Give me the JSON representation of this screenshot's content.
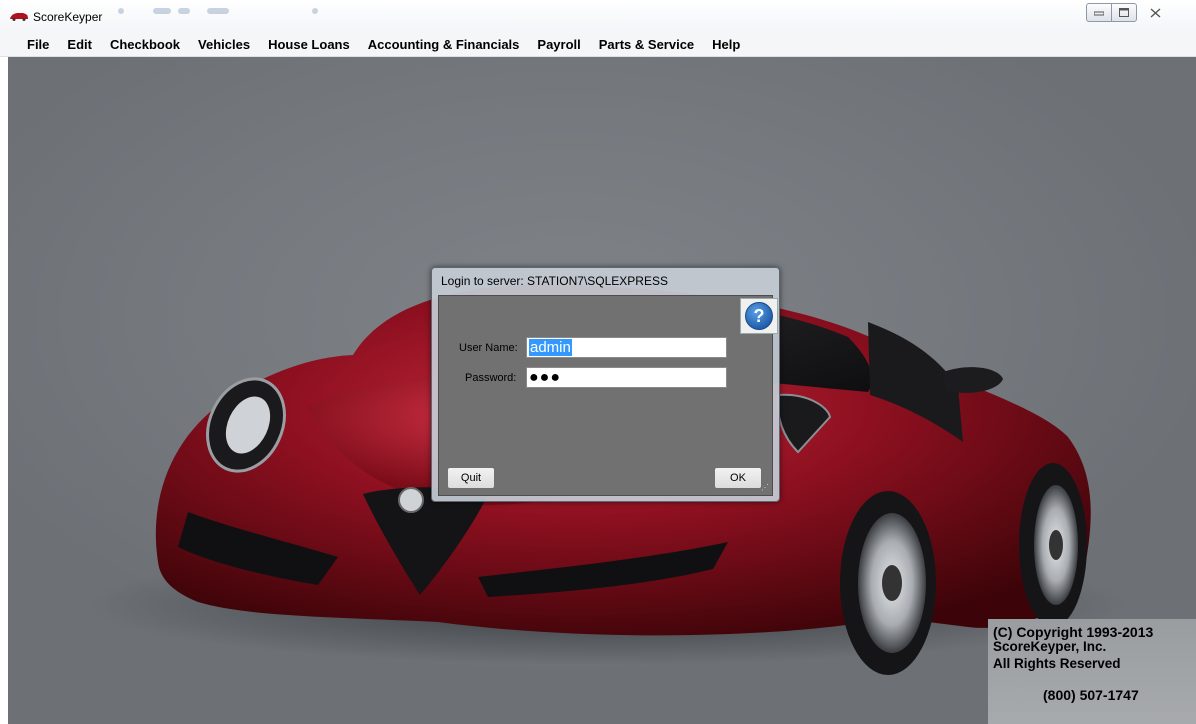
{
  "window": {
    "title": "ScoreKeyper"
  },
  "menu": [
    "File",
    "Edit",
    "Checkbook",
    "Vehicles",
    "House Loans",
    "Accounting & Financials",
    "Payroll",
    "Parts & Service",
    "Help"
  ],
  "dialog": {
    "title": "Login to server:  STATION7\\SQLEXPRESS",
    "username_label": "User Name:",
    "username_value": "admin",
    "password_label": "Password:",
    "password_mask": "●●●",
    "quit_label": "Quit",
    "ok_label": "OK"
  },
  "copyright": {
    "line1": "(C) Copyright 1993-2013",
    "line2": "ScoreKeyper, Inc.",
    "line3": "All Rights Reserved",
    "phone": "(800) 507-1747"
  },
  "colors": {
    "car": "#8e1020",
    "selection": "#3399ff",
    "dialog_body": "#717171"
  }
}
